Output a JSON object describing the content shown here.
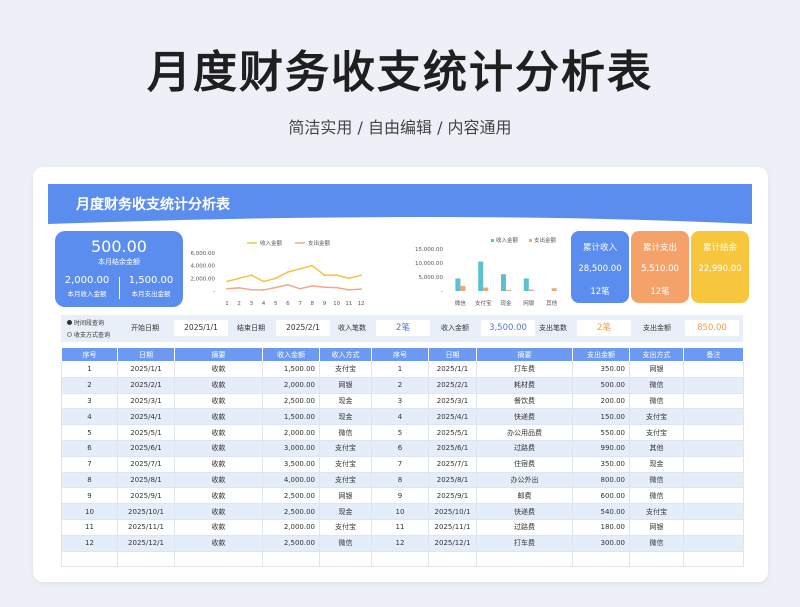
{
  "page": {
    "title": "月度财务收支统计分析表",
    "subtitle": "简洁实用 / 自由编辑 / 内容通用"
  },
  "sheet": {
    "banner_title": "月度财务收支统计分析表",
    "accent": "#5b8def",
    "kpi_main": {
      "balance": "500.00",
      "balance_label": "本月结余金额",
      "income": "2,000.00",
      "income_label": "本月收入金额",
      "expense": "1,500.00",
      "expense_label": "本月支出金额"
    },
    "kpis": [
      {
        "title": "累计收入",
        "value": "28,500.00",
        "count": "12笔",
        "color": "#5b8def"
      },
      {
        "title": "累计支出",
        "value": "5,510.00",
        "count": "12笔",
        "color": "#f5a26a"
      },
      {
        "title": "累计结余",
        "value": "22,990.00",
        "count": "",
        "color": "#f7c63d"
      }
    ],
    "filter": {
      "radio_time": "时间段查询",
      "radio_method": "收支方式查询",
      "start_label": "开始日期",
      "start_value": "2025/1/1",
      "end_label": "结束日期",
      "end_value": "2025/2/1",
      "income_count_label": "收入笔数",
      "income_count": "2笔",
      "income_amount_label": "收入金额",
      "income_amount": "3,500.00",
      "expense_count_label": "支出笔数",
      "expense_count": "2笔",
      "expense_amount_label": "支出金额",
      "expense_amount": "850.00"
    },
    "headers": [
      "序号",
      "日期",
      "摘要",
      "收入金额",
      "收入方式",
      "序号",
      "日期",
      "摘要",
      "支出金额",
      "支出方式",
      "备注"
    ],
    "rows": [
      [
        "1",
        "2025/1/1",
        "收款",
        "1,500.00",
        "支付宝",
        "1",
        "2025/1/1",
        "打车费",
        "350.00",
        "网银",
        ""
      ],
      [
        "2",
        "2025/2/1",
        "收款",
        "2,000.00",
        "网银",
        "2",
        "2025/2/1",
        "耗材费",
        "500.00",
        "微信",
        ""
      ],
      [
        "3",
        "2025/3/1",
        "收款",
        "2,500.00",
        "现金",
        "3",
        "2025/3/1",
        "餐饮费",
        "200.00",
        "微信",
        ""
      ],
      [
        "4",
        "2025/4/1",
        "收款",
        "1,500.00",
        "现金",
        "4",
        "2025/4/1",
        "快递费",
        "150.00",
        "支付宝",
        ""
      ],
      [
        "5",
        "2025/5/1",
        "收款",
        "2,000.00",
        "微信",
        "5",
        "2025/5/1",
        "办公用品费",
        "550.00",
        "支付宝",
        ""
      ],
      [
        "6",
        "2025/6/1",
        "收款",
        "3,000.00",
        "支付宝",
        "6",
        "2025/6/1",
        "过路费",
        "990.00",
        "其他",
        ""
      ],
      [
        "7",
        "2025/7/1",
        "收款",
        "3,500.00",
        "支付宝",
        "7",
        "2025/7/1",
        "住宿费",
        "350.00",
        "现金",
        ""
      ],
      [
        "8",
        "2025/8/1",
        "收款",
        "4,000.00",
        "支付宝",
        "8",
        "2025/8/1",
        "办公外出",
        "800.00",
        "微信",
        ""
      ],
      [
        "9",
        "2025/9/1",
        "收款",
        "2,500.00",
        "网银",
        "9",
        "2025/9/1",
        "邮费",
        "600.00",
        "微信",
        ""
      ],
      [
        "10",
        "2025/10/1",
        "收款",
        "2,500.00",
        "现金",
        "10",
        "2025/10/1",
        "快递费",
        "540.00",
        "支付宝",
        ""
      ],
      [
        "11",
        "2025/11/1",
        "收款",
        "2,000.00",
        "支付宝",
        "11",
        "2025/11/1",
        "过路费",
        "180.00",
        "网银",
        ""
      ],
      [
        "12",
        "2025/12/1",
        "收款",
        "2,500.00",
        "微信",
        "12",
        "2025/12/1",
        "打车费",
        "300.00",
        "微信",
        ""
      ],
      [
        "",
        "",
        "",
        "",
        "",
        "",
        "",
        "",
        "",
        "",
        ""
      ]
    ]
  },
  "chart_data": [
    {
      "type": "line",
      "x": [
        "1",
        "2",
        "3",
        "4",
        "5",
        "6",
        "7",
        "8",
        "9",
        "10",
        "11",
        "12"
      ],
      "ylim": [
        0,
        6000
      ],
      "yticks": [
        "6,000.00",
        "4,000.00",
        "2,000.00",
        "-"
      ],
      "series": [
        {
          "name": "收入金额",
          "color": "#f6c143",
          "values": [
            1500,
            2000,
            2500,
            1500,
            2000,
            3000,
            3500,
            4000,
            2500,
            2500,
            2000,
            2500
          ]
        },
        {
          "name": "支出金额",
          "color": "#f2a98a",
          "values": [
            350,
            500,
            200,
            150,
            550,
            990,
            350,
            800,
            600,
            540,
            180,
            300
          ]
        }
      ]
    },
    {
      "type": "bar",
      "categories": [
        "微信",
        "支付宝",
        "现金",
        "网银",
        "其他"
      ],
      "ylim": [
        0,
        15000
      ],
      "yticks": [
        "15,000.00",
        "10,000.00",
        "5,000.00",
        "-"
      ],
      "series": [
        {
          "name": "收入金额",
          "color": "#5bc0cf",
          "values": [
            4500,
            10500,
            6000,
            4500,
            0
          ]
        },
        {
          "name": "支出金额",
          "color": "#f0a779",
          "values": [
            1850,
            1240,
            350,
            530,
            990
          ]
        }
      ]
    }
  ]
}
